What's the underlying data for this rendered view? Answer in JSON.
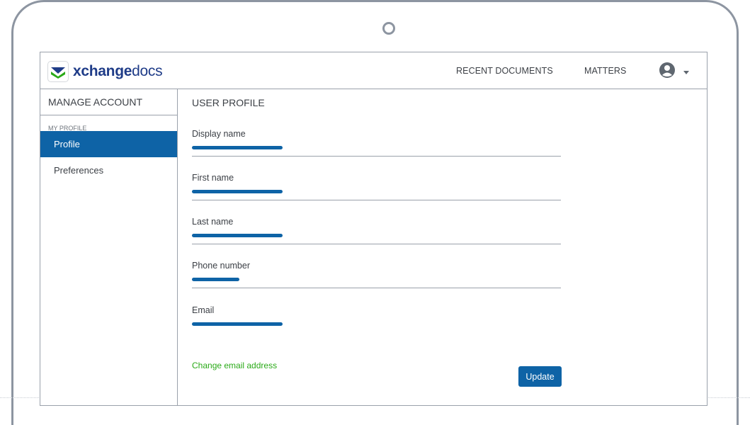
{
  "brand": {
    "name_bold": "xchange",
    "name_light": "docs",
    "colors": {
      "primary": "#0e63a6",
      "brand_navy": "#1f3c88",
      "brand_green": "#2aaa18",
      "link_green": "#2aaa18"
    }
  },
  "header": {
    "nav": [
      {
        "label": "RECENT DOCUMENTS"
      },
      {
        "label": "MATTERS"
      }
    ],
    "user_icon": "user-circle-icon",
    "dropdown_icon": "caret-down-icon"
  },
  "sidebar": {
    "title": "MANAGE ACCOUNT",
    "section": "MY PROFILE",
    "items": [
      {
        "label": "Profile",
        "active": true
      },
      {
        "label": "Preferences",
        "active": false
      }
    ]
  },
  "main": {
    "title": "USER PROFILE",
    "fields": [
      {
        "label": "Display name",
        "value_state": "redacted"
      },
      {
        "label": "First name",
        "value_state": "redacted"
      },
      {
        "label": "Last name",
        "value_state": "redacted"
      },
      {
        "label": "Phone number",
        "value_state": "redacted"
      },
      {
        "label": "Email",
        "value_state": "redacted"
      }
    ],
    "change_email": "Change email address",
    "update_label": "Update"
  }
}
